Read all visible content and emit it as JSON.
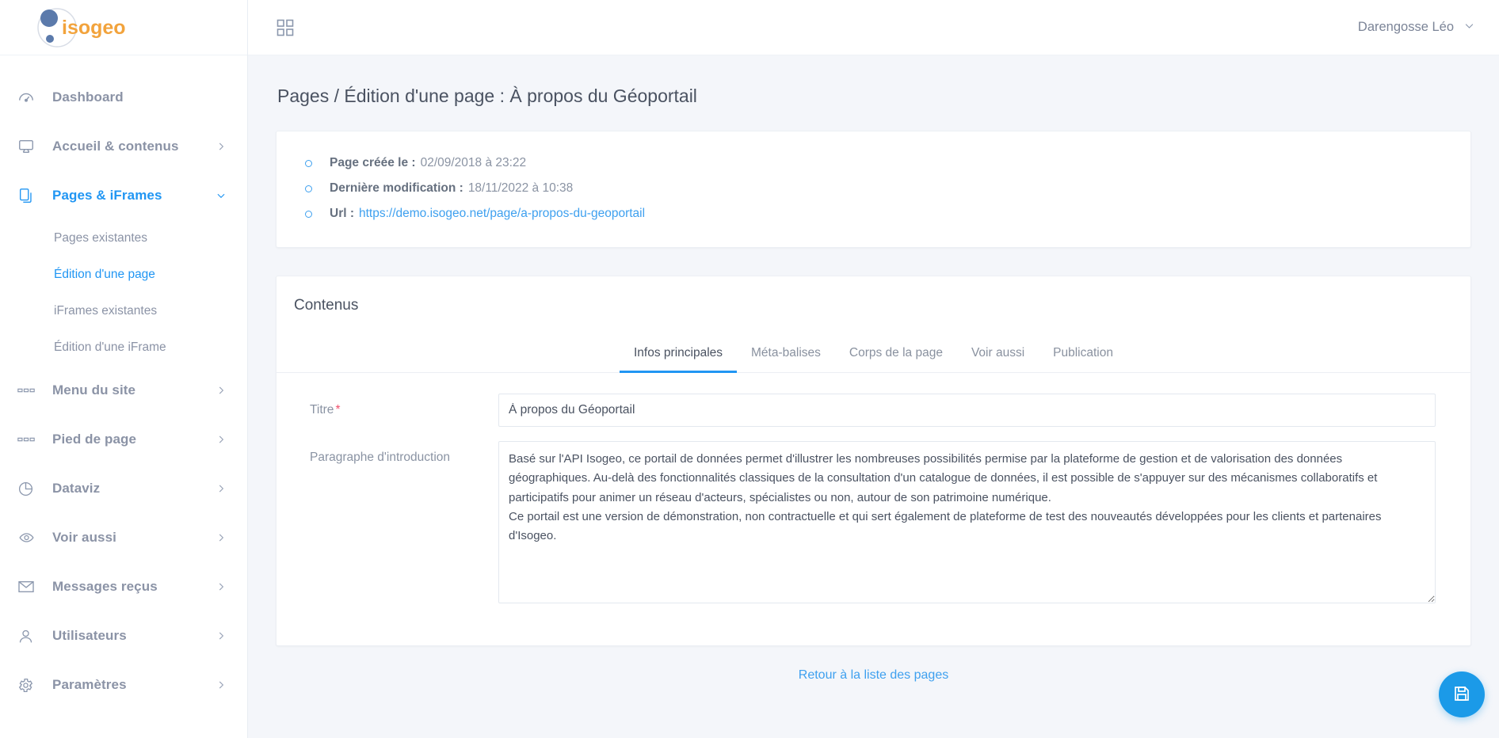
{
  "brand": {
    "name": "isogeo",
    "logo_colors": {
      "dot": "#5b7aab",
      "text": "#f2a33c"
    }
  },
  "colors": {
    "accent": "#2196f3",
    "link": "#3ea0ef",
    "required": "#f0516d",
    "fab": "#1b9ae8"
  },
  "topbar": {
    "grid_icon": "grid-apps-icon",
    "user_name": "Darengosse Léo",
    "user_chevron": "chevron-down-icon"
  },
  "sidebar": {
    "items": [
      {
        "label": "Dashboard",
        "icon": "dashboard-gauge-icon",
        "chevron": false,
        "active": false
      },
      {
        "label": "Accueil & contenus",
        "icon": "monitor-icon",
        "chevron": true,
        "active": false
      },
      {
        "label": "Pages & iFrames",
        "icon": "pages-copy-icon",
        "chevron": true,
        "active": true,
        "expanded": true
      },
      {
        "label": "Menu du site",
        "icon": "menu-bars-icon",
        "chevron": true,
        "active": false
      },
      {
        "label": "Pied de page",
        "icon": "menu-bars-icon",
        "chevron": true,
        "active": false
      },
      {
        "label": "Dataviz",
        "icon": "pie-chart-icon",
        "chevron": true,
        "active": false
      },
      {
        "label": "Voir aussi",
        "icon": "eye-icon",
        "chevron": true,
        "active": false
      },
      {
        "label": "Messages reçus",
        "icon": "envelope-icon",
        "chevron": true,
        "active": false
      },
      {
        "label": "Utilisateurs",
        "icon": "user-icon",
        "chevron": true,
        "active": false
      },
      {
        "label": "Paramètres",
        "icon": "gear-icon",
        "chevron": true,
        "active": false
      }
    ],
    "subitems": [
      {
        "label": "Pages existantes",
        "active": false
      },
      {
        "label": "Édition d'une page",
        "active": true
      },
      {
        "label": "iFrames existantes",
        "active": false
      },
      {
        "label": "Édition d'une iFrame",
        "active": false
      }
    ]
  },
  "page": {
    "title": "Pages / Édition d'une page : À propos du Géoportail",
    "info": [
      {
        "key": "Page créée le :",
        "value": "02/09/2018 à 23:22",
        "is_link": false
      },
      {
        "key": "Dernière modification :",
        "value": "18/11/2022 à 10:38",
        "is_link": false
      },
      {
        "key": "Url :",
        "value": "https://demo.isogeo.net/page/a-propos-du-geoportail",
        "is_link": true
      }
    ]
  },
  "content_card": {
    "heading": "Contenus",
    "tabs": [
      {
        "label": "Infos principales",
        "active": true
      },
      {
        "label": "Méta-balises",
        "active": false
      },
      {
        "label": "Corps de la page",
        "active": false
      },
      {
        "label": "Voir aussi",
        "active": false
      },
      {
        "label": "Publication",
        "active": false
      }
    ],
    "fields": {
      "title_label": "Titre",
      "title_required_mark": "*",
      "title_value": "À propos du Géoportail",
      "title_placeholder": "",
      "intro_label": "Paragraphe d'introduction",
      "intro_value": "Basé sur l'API Isogeo, ce portail de données permet d'illustrer les nombreuses possibilités permise par la plateforme de gestion et de valorisation des données géographiques. Au-delà des fonctionnalités classiques de la consultation d'un catalogue de données, il est possible de s'appuyer sur des mécanismes collaboratifs et participatifs pour animer un réseau d'acteurs, spécialistes ou non, autour de son patrimoine numérique.\nCe portail est une version de démonstration, non contractuelle et qui sert également de plateforme de test des nouveautés développées pour les clients et partenaires d'Isogeo.",
      "intro_placeholder": ""
    }
  },
  "footer": {
    "back_link": "Retour à la liste des pages"
  },
  "fab": {
    "icon": "save-floppy-icon",
    "label": "Enregistrer"
  }
}
